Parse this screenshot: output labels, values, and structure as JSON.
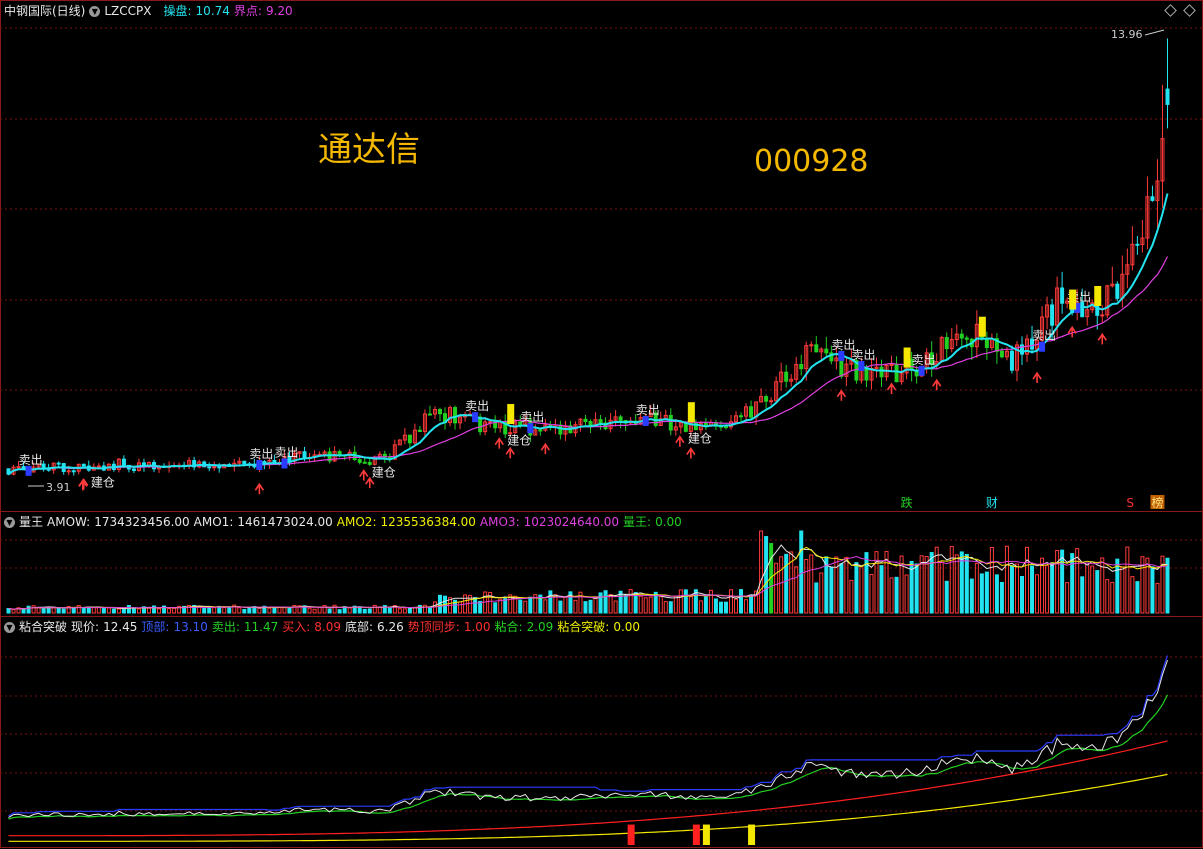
{
  "colors": {
    "up": "#ff3a3a",
    "down": "#22e4f0",
    "white": "#e8e8e8",
    "cyan": "#22e4f0",
    "magenta": "#e040e0",
    "yellow": "#f5e800",
    "blue": "#2a3cff",
    "green": "#22d022",
    "red_line": "#ff2020",
    "grid": "#7a1010"
  },
  "header": {
    "title": "中钢国际(日线)",
    "indicator": "LZCCPX",
    "caopan_label": "操盘: ",
    "caopan_value": "10.74",
    "jiedian_label": "界点: ",
    "jiedian_value": "9.20"
  },
  "overlay": {
    "brand": "通达信",
    "code": "000928"
  },
  "main_chart": {
    "max_label": "13.96",
    "min_label": "3.91",
    "events": [
      {
        "label": "卖出",
        "day": 4,
        "kind": "sell"
      },
      {
        "label": "建仓",
        "day": 18,
        "kind": "buy"
      },
      {
        "label": "卖出",
        "day": 50,
        "kind": "sell"
      },
      {
        "label": "卖出",
        "day": 55,
        "kind": "sell"
      },
      {
        "label": "建仓",
        "day": 74,
        "kind": "buy"
      },
      {
        "label": "卖出",
        "day": 93,
        "kind": "sell"
      },
      {
        "label": "建仓",
        "day": 101,
        "kind": "buy"
      },
      {
        "label": "卖出",
        "day": 104,
        "kind": "sell"
      },
      {
        "label": "卖出",
        "day": 127,
        "kind": "sell"
      },
      {
        "label": "建仓",
        "day": 137,
        "kind": "buy"
      },
      {
        "label": "卖出",
        "day": 166,
        "kind": "sell"
      },
      {
        "label": "卖出",
        "day": 170,
        "kind": "sell"
      },
      {
        "label": "卖出",
        "day": 182,
        "kind": "sell"
      },
      {
        "label": "卖出",
        "day": 206,
        "kind": "sell"
      },
      {
        "label": "卖出",
        "day": 213,
        "kind": "sell"
      }
    ],
    "footer_tags": [
      {
        "label": "跌",
        "day": 179,
        "color": "#22d022"
      },
      {
        "label": "财",
        "day": 196,
        "color": "#22e4f0"
      },
      {
        "label": "S",
        "day": 224,
        "color": "#ff3030"
      },
      {
        "label": "榜",
        "day": 229,
        "color": "#f5b800"
      }
    ]
  },
  "volume_panel": {
    "name": "量王",
    "amow_label": "AMOW: ",
    "amow_value": "1734323456.00",
    "amo1_label": "AMO1: ",
    "amo1_value": "1461473024.00",
    "amo2_label": "AMO2: ",
    "amo2_value": "1235536384.00",
    "amo3_label": "AMO3: ",
    "amo3_value": "1023024640.00",
    "lw_label": "量王: ",
    "lw_value": "0.00"
  },
  "breakout_panel": {
    "name": "粘合突破",
    "xj_label": "现价: ",
    "xj_value": "12.45",
    "db_label": "顶部: ",
    "db_value": "13.10",
    "mc_label": "卖出: ",
    "mc_value": "11.47",
    "mr_label": "买入: ",
    "mr_value": "8.09",
    "dib_label": "底部: ",
    "dib_value": "6.26",
    "sd_label": "势顶同步: ",
    "sd_value": "1.00",
    "nh_label": "粘合: ",
    "nh_value": "2.09",
    "nhtp_label": "粘合突破: ",
    "nhtp_value": "0.00"
  },
  "chart_data": {
    "type": "candlestick",
    "days": 232,
    "price_range": [
      3.5,
      14.2
    ],
    "price_anchor": {
      "start": 4.1,
      "end": 12.45,
      "high": 13.96,
      "low": 3.91
    },
    "series": [
      {
        "name": "操盘",
        "color": "#22e4f0",
        "last": 10.74
      },
      {
        "name": "界点",
        "color": "#e040e0",
        "last": 9.2
      }
    ]
  }
}
